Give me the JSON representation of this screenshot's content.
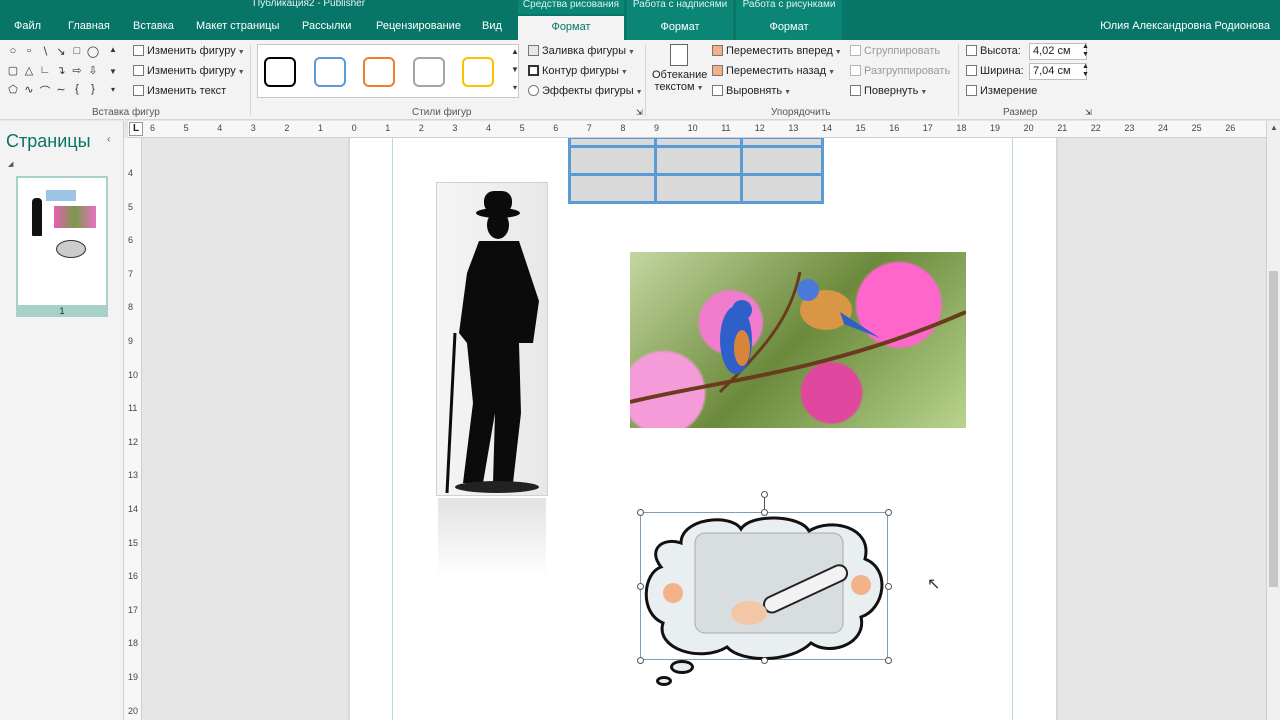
{
  "window": {
    "title": "Публикация2 - Publisher",
    "user": "Юлия Александровна Родионова"
  },
  "context_headers": {
    "drawing": "Средства рисования",
    "textbox": "Работа с надписями",
    "picture": "Работа с рисунками"
  },
  "tabs": [
    {
      "label": "Файл"
    },
    {
      "label": "Главная"
    },
    {
      "label": "Вставка"
    },
    {
      "label": "Макет страницы"
    },
    {
      "label": "Рассылки"
    },
    {
      "label": "Рецензирование"
    },
    {
      "label": "Вид"
    },
    {
      "label": "Формат"
    },
    {
      "label": "Формат"
    },
    {
      "label": "Формат"
    }
  ],
  "ribbon": {
    "insert_shapes": {
      "change_shape_1": "Изменить фигуру",
      "change_shape_2": "Изменить фигуру",
      "edit_text": "Изменить текст",
      "group_label": "Вставка фигур"
    },
    "shape_styles": {
      "group_label": "Стили фигур",
      "swatch_colors": [
        "#000000",
        "#5b9bd5",
        "#ed7d31",
        "#a5a5a5",
        "#ffc000"
      ],
      "fill": "Заливка фигуры",
      "outline": "Контур фигуры",
      "effects": "Эффекты фигуры"
    },
    "arrange": {
      "wrap_text_1": "Обтекание",
      "wrap_text_2": "текстом",
      "bring_forward": "Переместить вперед",
      "send_backward": "Переместить назад",
      "align": "Выровнять",
      "group": "Сгруппировать",
      "ungroup": "Разгруппировать",
      "rotate": "Повернуть",
      "group_label": "Упорядочить"
    },
    "size": {
      "height_label": "Высота:",
      "height_value": "4,02 см",
      "width_label": "Ширина:",
      "width_value": "7,04 см",
      "measure": "Измерение",
      "group_label": "Размер"
    }
  },
  "pages_panel": {
    "title": "Страницы",
    "page_number": "1"
  },
  "ruler": {
    "corner": "L",
    "h_ticks": [
      "6",
      "5",
      "4",
      "3",
      "2",
      "1",
      "0",
      "1",
      "2",
      "3",
      "4",
      "5",
      "6",
      "7",
      "8",
      "9",
      "10",
      "11",
      "12",
      "13",
      "14",
      "15",
      "16",
      "17",
      "18",
      "19",
      "20",
      "21",
      "22",
      "23",
      "24",
      "25",
      "26"
    ],
    "v_ticks": [
      "4",
      "5",
      "6",
      "7",
      "8",
      "9",
      "10",
      "11",
      "12",
      "13",
      "14",
      "15",
      "16",
      "17",
      "18",
      "19",
      "20"
    ]
  },
  "colors": {
    "accent": "#077568",
    "table_border": "#5b9bd5"
  }
}
